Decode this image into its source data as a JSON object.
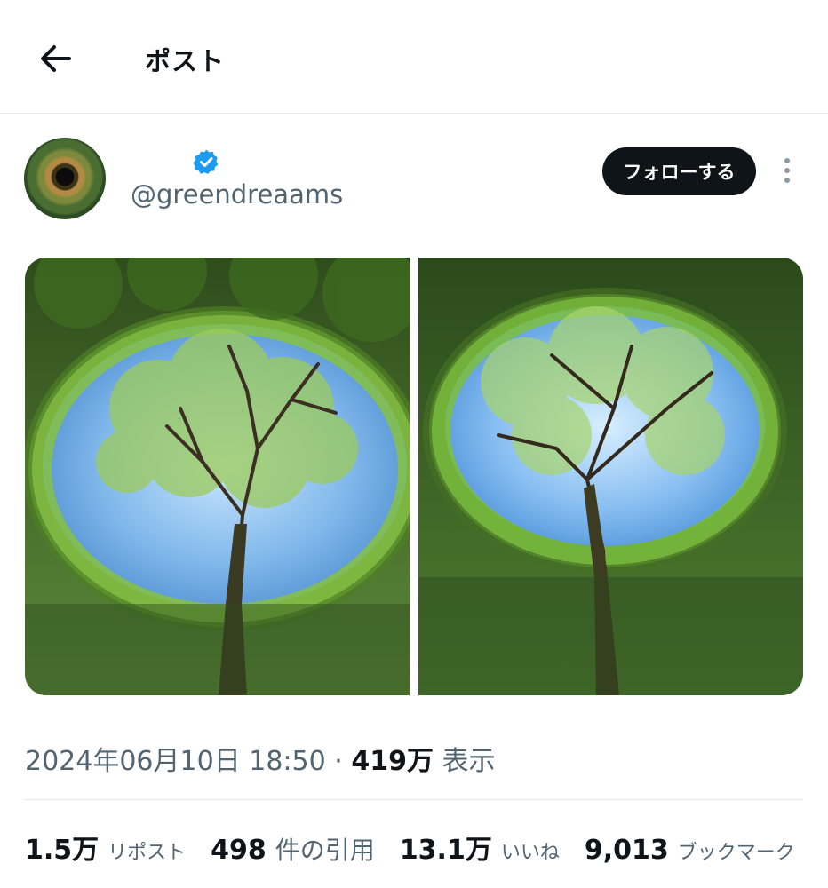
{
  "header": {
    "back_icon": "arrow-left-icon",
    "title": "ポスト"
  },
  "author": {
    "handle": "@greendreaams",
    "verified_badge": "verified-check-icon",
    "verified_color": "#1d9bf0",
    "follow_label": "フォローする",
    "more_icon": "more-vertical-icon"
  },
  "media": {
    "images": [
      "tree-in-vine-well-photo-1",
      "tree-in-vine-well-photo-2"
    ]
  },
  "post_meta": {
    "timestamp": "2024年06月10日 18:50",
    "separator": "·",
    "views_count": "419万",
    "views_label": "表示"
  },
  "stats": {
    "reposts": {
      "value": "1.5万",
      "label": "リポスト"
    },
    "quotes": {
      "value": "498",
      "label": "件の引用"
    },
    "likes": {
      "value": "13.1万",
      "label": "いいね"
    },
    "bookmarks": {
      "value": "9,013",
      "label": "ブックマーク"
    }
  },
  "colors": {
    "text_primary": "#0f1419",
    "text_secondary": "#536471",
    "divider": "#e6e9eb"
  }
}
